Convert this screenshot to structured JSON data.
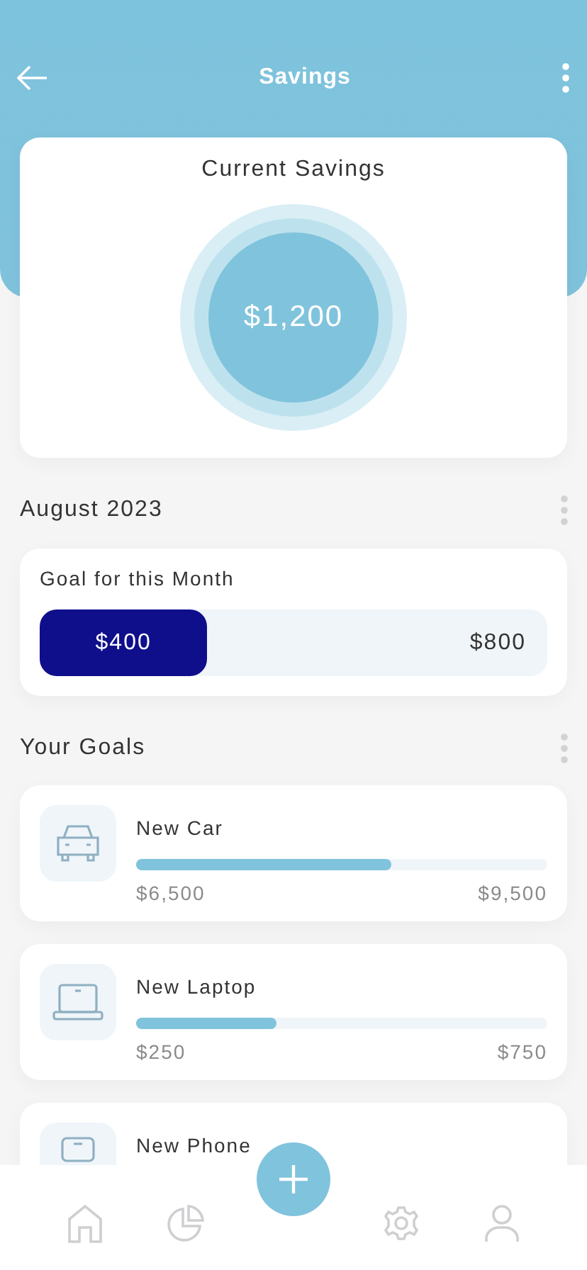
{
  "header": {
    "title": "Savings"
  },
  "current_savings": {
    "title": "Current Savings",
    "amount": "$1,200"
  },
  "month": {
    "title": "August 2023",
    "goal_label": "Goal for this Month",
    "saved": "$400",
    "target": "$800",
    "level": 0.33
  },
  "goals_section": {
    "title": "Your Goals"
  },
  "goals": [
    {
      "kind": "car",
      "name": "New Car",
      "saved": "$6,500",
      "target": "$9,500",
      "level": 0.62
    },
    {
      "kind": "laptop",
      "name": "New Laptop",
      "saved": "$250",
      "target": "$750",
      "level": 0.34
    },
    {
      "kind": "phone",
      "name": "New Phone"
    }
  ],
  "nav": [
    {
      "kind": "home"
    },
    {
      "kind": "chart"
    },
    {
      "kind": "add"
    },
    {
      "kind": "settings"
    },
    {
      "kind": "profile"
    }
  ]
}
